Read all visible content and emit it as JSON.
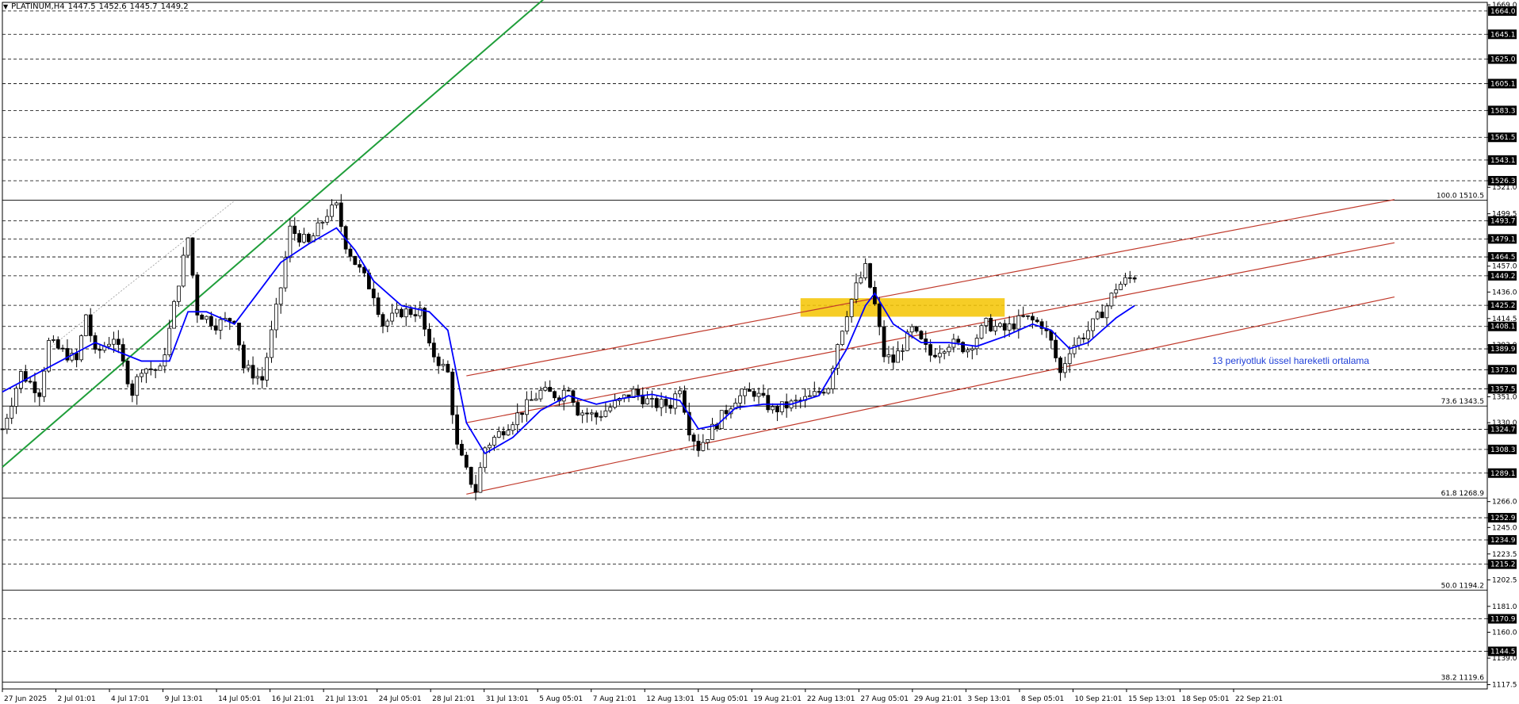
{
  "chart_data": {
    "type": "line",
    "subtype": "candlestick",
    "symbol_line": {
      "symbol": "PLATINUM,H4",
      "open": "1447.5",
      "high": "1452.6",
      "low": "1445.7",
      "close": "1449.2"
    },
    "y_ticks": [
      "1669.0",
      "1645.1",
      "1625.0",
      "1605.1",
      "1583.3",
      "1561.5",
      "1543.1",
      "1526.3",
      "1521.0",
      "1499.5",
      "1493.7",
      "1479.1",
      "1464.5",
      "1457.0",
      "1449.2",
      "1436.0",
      "1425.2",
      "1414.5",
      "1408.1",
      "1393.0",
      "1389.9",
      "1373.0",
      "1357.5",
      "1351.0",
      "1330.0",
      "1324.7",
      "1308.3",
      "1289.1",
      "1266.0",
      "1252.9",
      "1245.0",
      "1234.9",
      "1223.5",
      "1215.2",
      "1202.5",
      "1181.0",
      "1170.9",
      "1160.0",
      "1144.5",
      "1139.0",
      "1117.5"
    ],
    "highlighted_levels": [
      "1664.0",
      "1645.1",
      "1625.0",
      "1605.1",
      "1583.3",
      "1561.5",
      "1543.1",
      "1526.3",
      "1493.7",
      "1479.1",
      "1464.5",
      "1449.2",
      "1425.2",
      "1408.1",
      "1389.9",
      "1373.0",
      "1357.5",
      "1324.7",
      "1308.3",
      "1289.1",
      "1252.9",
      "1234.9",
      "1215.2",
      "1170.9",
      "1144.5"
    ],
    "x_ticks": [
      "27 Jun 2025",
      "2 Jul 01:01",
      "4 Jul 17:01",
      "9 Jul 13:01",
      "14 Jul 05:01",
      "16 Jul 21:01",
      "21 Jul 13:01",
      "24 Jul 05:01",
      "28 Jul 21:01",
      "31 Jul 13:01",
      "5 Aug 05:01",
      "7 Aug 21:01",
      "12 Aug 13:01",
      "15 Aug 05:01",
      "19 Aug 21:01",
      "22 Aug 13:01",
      "27 Aug 05:01",
      "29 Aug 21:01",
      "3 Sep 13:01",
      "8 Sep 05:01",
      "10 Sep 21:01",
      "15 Sep 13:01",
      "18 Sep 05:01",
      "22 Sep 21:01"
    ],
    "fibonacci_levels": [
      {
        "label": "100.0 1510.5",
        "value": 1510.5
      },
      {
        "label": "73.6 1343.5",
        "value": 1343.5
      },
      {
        "label": "61.8 1268.9",
        "value": 1268.9
      },
      {
        "label": "50.0 1194.2",
        "value": 1194.2
      },
      {
        "label": "38.2 1119.6",
        "value": 1119.6
      }
    ],
    "price_path": [
      [
        0,
        1325
      ],
      [
        2,
        1370
      ],
      [
        4,
        1355
      ],
      [
        5,
        1395
      ],
      [
        8,
        1380
      ],
      [
        9,
        1418
      ],
      [
        10,
        1385
      ],
      [
        12,
        1400
      ],
      [
        14,
        1355
      ],
      [
        15,
        1375
      ],
      [
        17,
        1372
      ],
      [
        18,
        1405
      ],
      [
        19,
        1445
      ],
      [
        20,
        1480
      ],
      [
        21,
        1420
      ],
      [
        23,
        1410
      ],
      [
        25,
        1415
      ],
      [
        26,
        1375
      ],
      [
        28,
        1365
      ],
      [
        30,
        1440
      ],
      [
        31,
        1487
      ],
      [
        33,
        1475
      ],
      [
        35,
        1500
      ],
      [
        36,
        1505
      ],
      [
        37,
        1475
      ],
      [
        38,
        1460
      ],
      [
        40,
        1435
      ],
      [
        41,
        1410
      ],
      [
        43,
        1420
      ],
      [
        45,
        1420
      ],
      [
        46,
        1390
      ],
      [
        48,
        1370
      ],
      [
        49,
        1310
      ],
      [
        50,
        1290
      ],
      [
        51,
        1275
      ],
      [
        52,
        1310
      ],
      [
        54,
        1325
      ],
      [
        56,
        1340
      ],
      [
        58,
        1355
      ],
      [
        60,
        1352
      ],
      [
        61,
        1360
      ],
      [
        62,
        1340
      ],
      [
        64,
        1335
      ],
      [
        66,
        1345
      ],
      [
        68,
        1355
      ],
      [
        70,
        1345
      ],
      [
        72,
        1345
      ],
      [
        73,
        1360
      ],
      [
        74,
        1325
      ],
      [
        75,
        1310
      ],
      [
        77,
        1330
      ],
      [
        79,
        1350
      ],
      [
        81,
        1355
      ],
      [
        83,
        1340
      ],
      [
        85,
        1345
      ],
      [
        87,
        1350
      ],
      [
        89,
        1360
      ],
      [
        90,
        1395
      ],
      [
        91,
        1420
      ],
      [
        92,
        1440
      ],
      [
        93,
        1455
      ],
      [
        94,
        1425
      ],
      [
        95,
        1385
      ],
      [
        96,
        1380
      ],
      [
        98,
        1405
      ],
      [
        100,
        1385
      ],
      [
        102,
        1395
      ],
      [
        104,
        1390
      ],
      [
        106,
        1410
      ],
      [
        108,
        1405
      ],
      [
        110,
        1415
      ],
      [
        112,
        1410
      ],
      [
        113,
        1395
      ],
      [
        114,
        1370
      ],
      [
        115,
        1390
      ],
      [
        117,
        1405
      ],
      [
        119,
        1425
      ],
      [
        120,
        1440
      ],
      [
        121,
        1445
      ],
      [
        122,
        1449.2
      ]
    ],
    "ema_13_path": [
      [
        0,
        1355
      ],
      [
        5,
        1375
      ],
      [
        10,
        1395
      ],
      [
        15,
        1380
      ],
      [
        18,
        1380
      ],
      [
        20,
        1420
      ],
      [
        22,
        1420
      ],
      [
        25,
        1410
      ],
      [
        28,
        1440
      ],
      [
        30,
        1460
      ],
      [
        33,
        1475
      ],
      [
        36,
        1488
      ],
      [
        38,
        1470
      ],
      [
        40,
        1445
      ],
      [
        43,
        1425
      ],
      [
        46,
        1420
      ],
      [
        48,
        1405
      ],
      [
        50,
        1330
      ],
      [
        52,
        1305
      ],
      [
        55,
        1318
      ],
      [
        58,
        1340
      ],
      [
        61,
        1352
      ],
      [
        64,
        1345
      ],
      [
        67,
        1350
      ],
      [
        70,
        1353
      ],
      [
        73,
        1348
      ],
      [
        75,
        1325
      ],
      [
        77,
        1328
      ],
      [
        79,
        1342
      ],
      [
        82,
        1345
      ],
      [
        85,
        1345
      ],
      [
        88,
        1352
      ],
      [
        91,
        1390
      ],
      [
        93,
        1425
      ],
      [
        94,
        1435
      ],
      [
        96,
        1410
      ],
      [
        99,
        1395
      ],
      [
        102,
        1395
      ],
      [
        105,
        1392
      ],
      [
        108,
        1400
      ],
      [
        111,
        1410
      ],
      [
        113,
        1405
      ],
      [
        115,
        1390
      ],
      [
        117,
        1395
      ],
      [
        120,
        1415
      ],
      [
        122,
        1425
      ]
    ],
    "channel_lines": [
      {
        "name": "channel-upper",
        "start": [
          50,
          1368
        ],
        "end": [
          150,
          1511
        ]
      },
      {
        "name": "channel-middle",
        "start": [
          50,
          1330
        ],
        "end": [
          150,
          1476
        ]
      },
      {
        "name": "channel-lower",
        "start": [
          50,
          1272
        ],
        "end": [
          150,
          1432
        ]
      }
    ],
    "trendline": {
      "start": [
        0,
        1294
      ],
      "end": [
        61,
        1691
      ]
    },
    "dotted_trendline": {
      "start": [
        5,
        1390
      ],
      "end": [
        25,
        1510
      ]
    },
    "zone": {
      "x_start": 86,
      "x_end": 108,
      "y_low": 1416,
      "y_high": 1431
    },
    "annotation": "13 periyotluk üssel hareketli ortalama",
    "colors": {
      "candles": "#000000",
      "ema": "#0000ff",
      "channel": "#c0392b",
      "trendline": "#1f9e3a",
      "zone": "#f5c400",
      "grid": "#000000",
      "highlight_bg": "#000000",
      "highlight_text": "#ffffff",
      "annotation": "#1f3fd8"
    },
    "grid": true
  }
}
